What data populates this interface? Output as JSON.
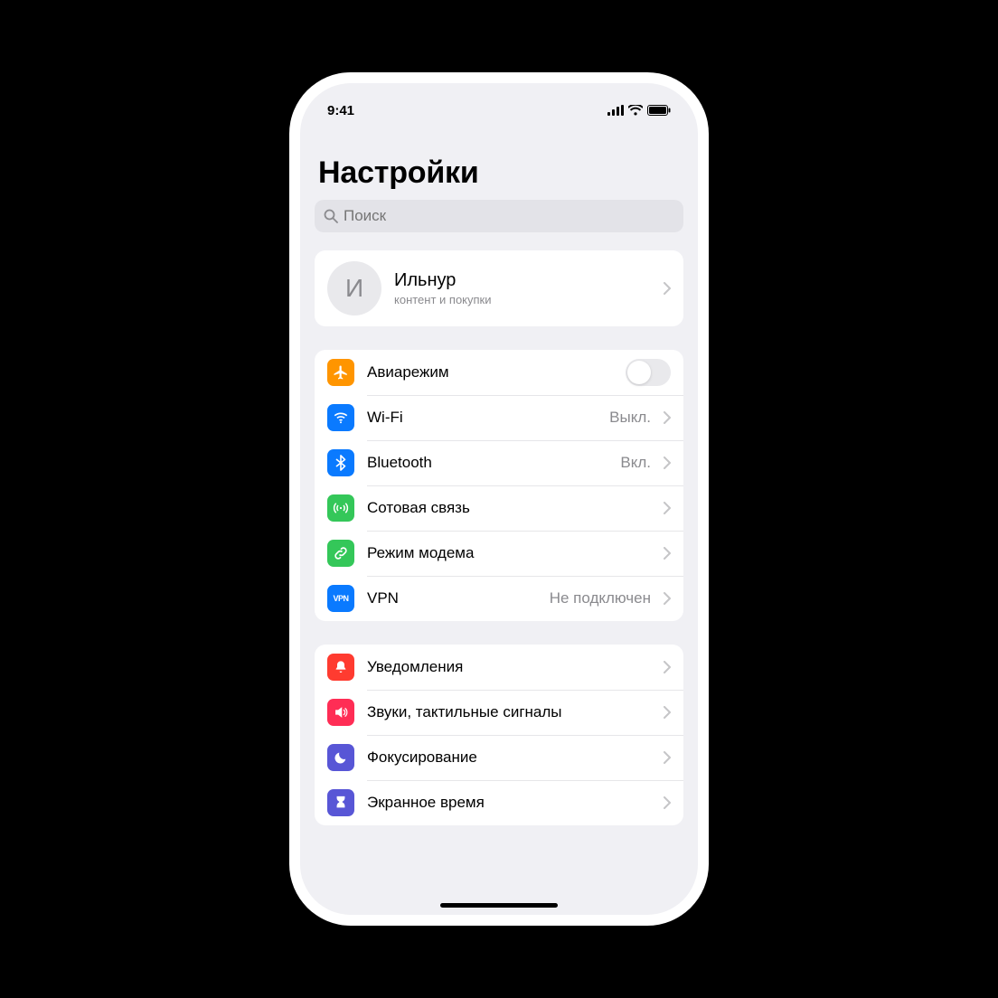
{
  "statusbar": {
    "time": "9:41"
  },
  "page_title": "Настройки",
  "search": {
    "placeholder": "Поиск"
  },
  "profile": {
    "initial": "И",
    "name": "Ильнур",
    "subtitle": "контент и покупки"
  },
  "groups": [
    {
      "id": "connectivity",
      "rows": [
        {
          "id": "airplane",
          "label": "Авиарежим",
          "icon": "airplane",
          "color": "#ff9500",
          "control": "toggle",
          "toggle_on": false
        },
        {
          "id": "wifi",
          "label": "Wi-Fi",
          "icon": "wifi",
          "color": "#0a7aff",
          "value": "Выкл.",
          "control": "disclosure"
        },
        {
          "id": "bluetooth",
          "label": "Bluetooth",
          "icon": "bluetooth",
          "color": "#0a7aff",
          "value": "Вкл.",
          "control": "disclosure"
        },
        {
          "id": "cellular",
          "label": "Сотовая связь",
          "icon": "antenna",
          "color": "#34c759",
          "control": "disclosure"
        },
        {
          "id": "hotspot",
          "label": "Режим модема",
          "icon": "link",
          "color": "#34c759",
          "control": "disclosure"
        },
        {
          "id": "vpn",
          "label": "VPN",
          "icon": "vpn",
          "color": "#0a7aff",
          "value": "Не подключен",
          "control": "disclosure"
        }
      ]
    },
    {
      "id": "attention",
      "rows": [
        {
          "id": "notifications",
          "label": "Уведомления",
          "icon": "bell",
          "color": "#ff3b30",
          "control": "disclosure"
        },
        {
          "id": "sounds",
          "label": "Звуки, тактильные сигналы",
          "icon": "speaker",
          "color": "#ff2d55",
          "control": "disclosure"
        },
        {
          "id": "focus",
          "label": "Фокусирование",
          "icon": "moon",
          "color": "#5856d6",
          "control": "disclosure"
        },
        {
          "id": "screentime",
          "label": "Экранное время",
          "icon": "hourglass",
          "color": "#5856d6",
          "control": "disclosure"
        }
      ]
    }
  ],
  "icons": {
    "vpn_text": "VPN"
  }
}
